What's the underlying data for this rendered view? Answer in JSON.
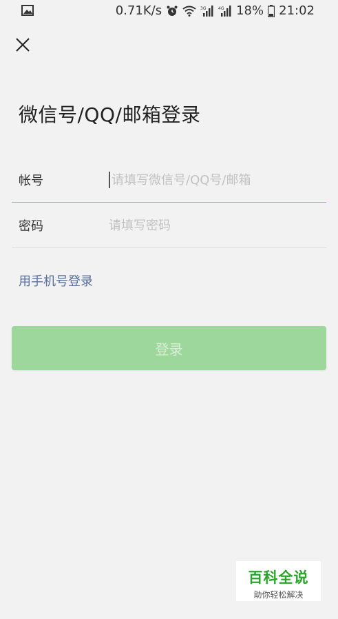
{
  "status_bar": {
    "net_speed": "0.71K/s",
    "battery_percent": "18%",
    "time": "21:02",
    "icons": [
      "image-icon",
      "alarm-icon",
      "wifi-icon",
      "signal-3g-icon",
      "signal-4g-icon",
      "battery-icon"
    ],
    "net_3g": "3G",
    "net_4g": "4G"
  },
  "header": {
    "close_icon": "close-icon",
    "title": "微信号/QQ/邮箱登录"
  },
  "form": {
    "account": {
      "label": "帐号",
      "placeholder": "请填写微信号/QQ号/邮箱",
      "value": ""
    },
    "password": {
      "label": "密码",
      "placeholder": "请填写密码",
      "value": ""
    }
  },
  "links": {
    "phone_login": "用手机号登录"
  },
  "buttons": {
    "login": "登录"
  },
  "watermark": {
    "title": "百科全说",
    "subtitle": "助你轻松解决"
  },
  "colors": {
    "accent_green": "#7ad27a",
    "button_disabled": "#9ed79c",
    "link": "#58709a",
    "background": "#f2f2f2"
  }
}
